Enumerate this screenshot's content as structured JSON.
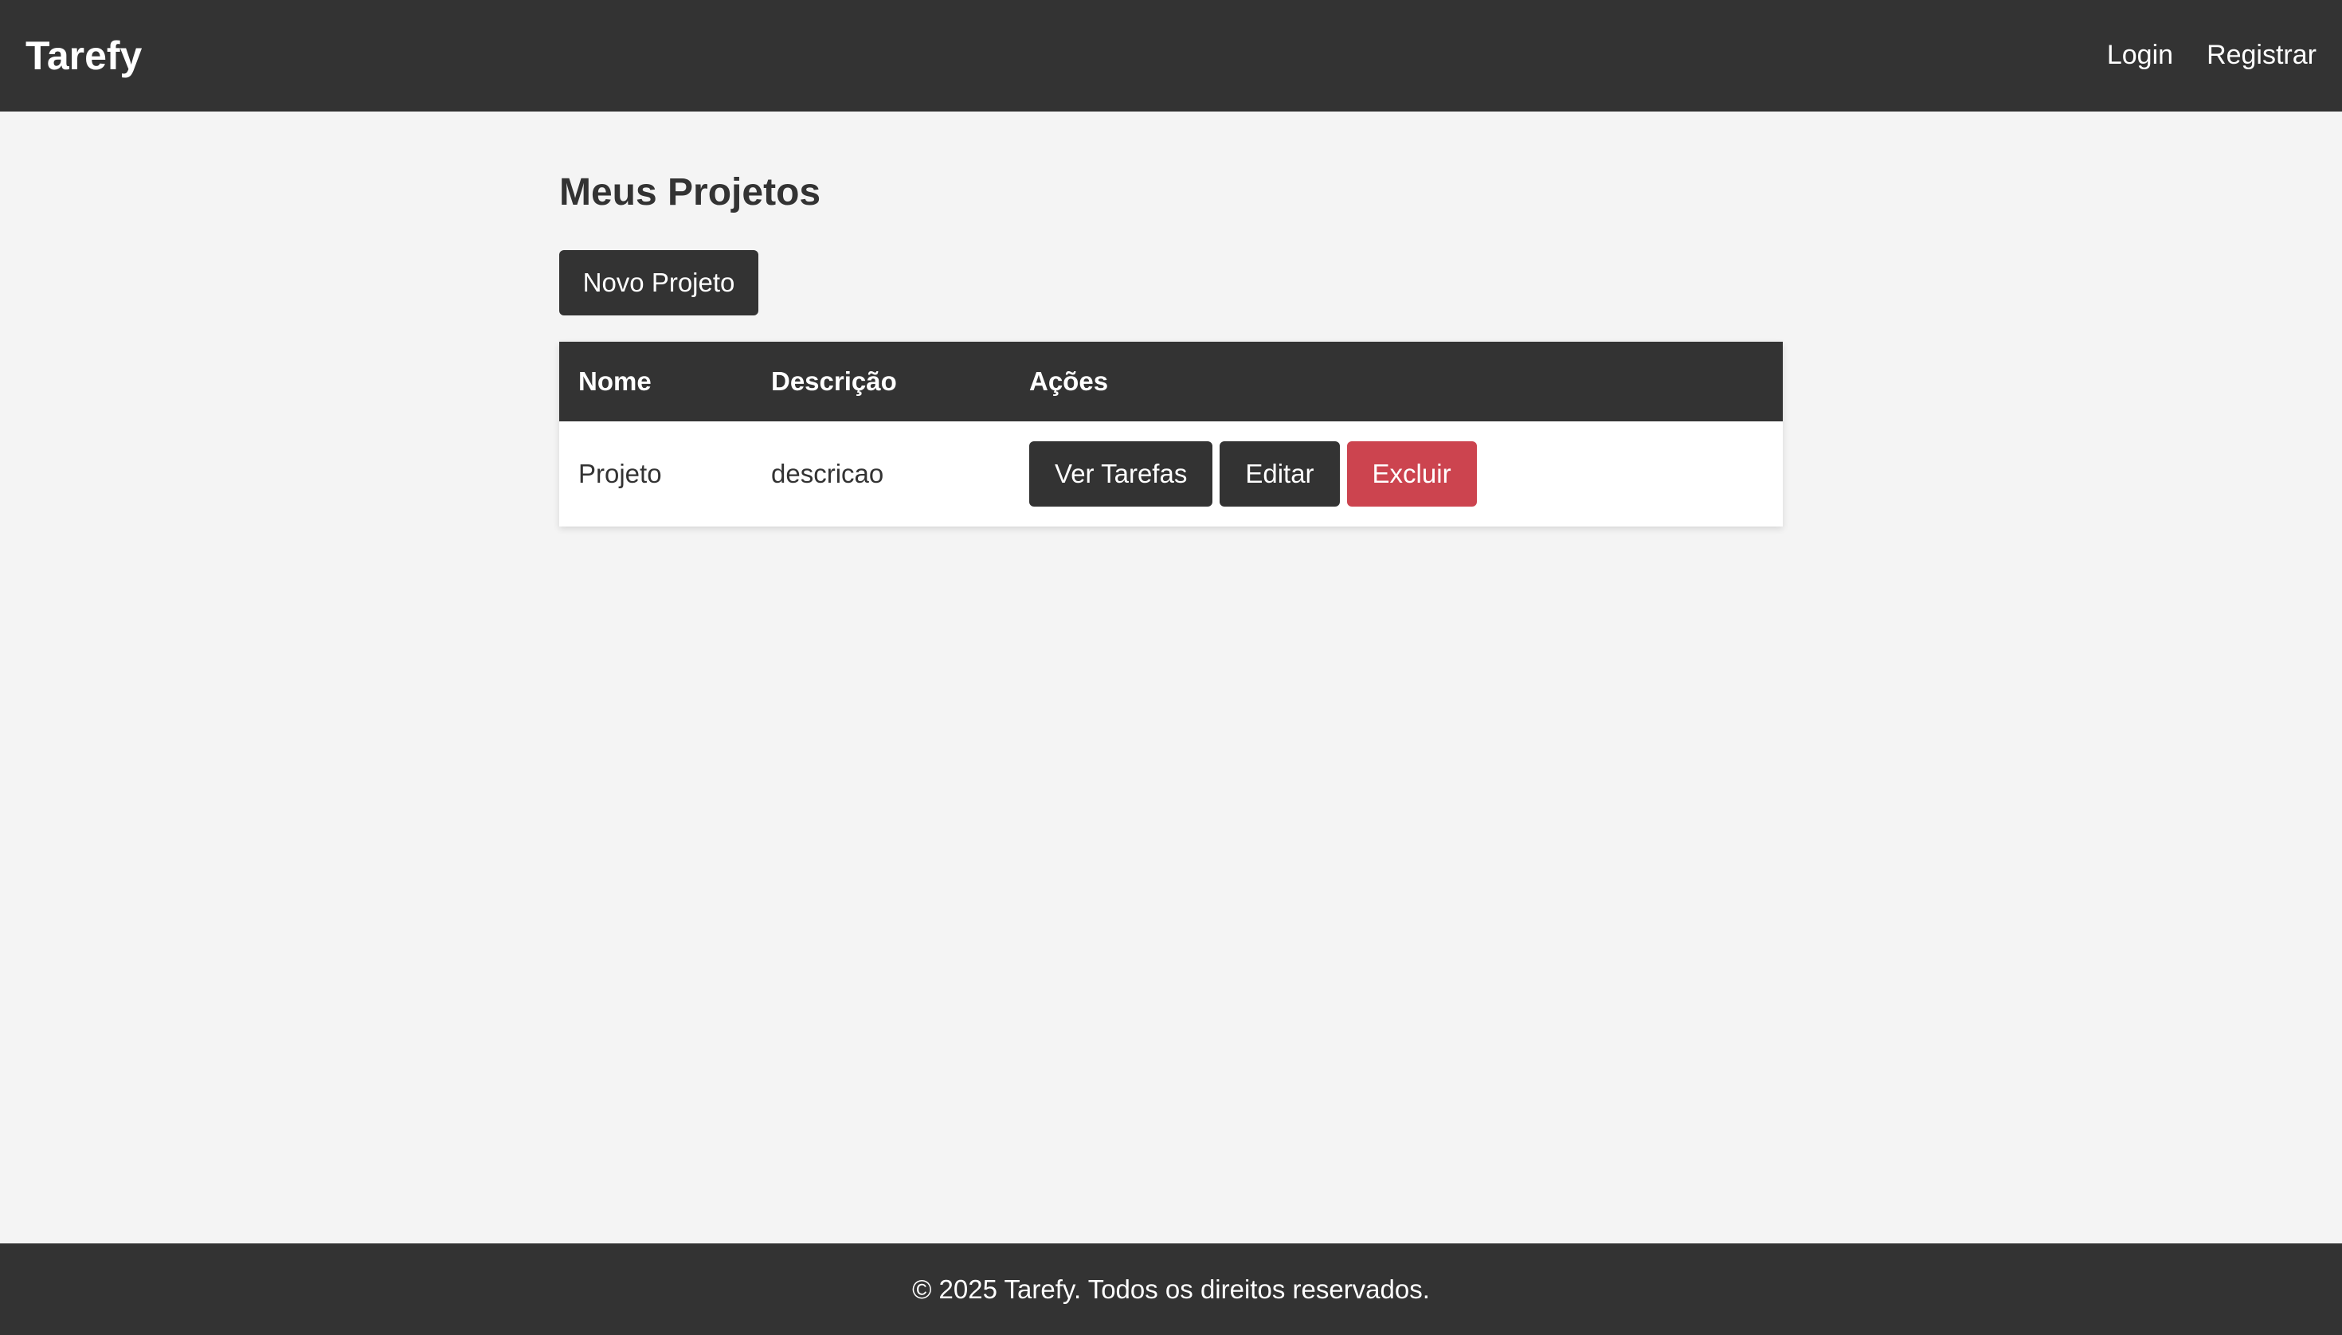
{
  "header": {
    "brand": "Tarefy",
    "nav": [
      {
        "label": "Login"
      },
      {
        "label": "Registrar"
      }
    ]
  },
  "main": {
    "title": "Meus Projetos",
    "new_project_label": "Novo Projeto",
    "table": {
      "columns": [
        "Nome",
        "Descrição",
        "Ações"
      ],
      "rows": [
        {
          "name": "Projeto",
          "description": "descricao",
          "actions": {
            "view_tasks": "Ver Tarefas",
            "edit": "Editar",
            "delete": "Excluir"
          }
        }
      ]
    }
  },
  "footer": {
    "text": "© 2025 Tarefy. Todos os direitos reservados."
  },
  "colors": {
    "header_bg": "#333333",
    "page_bg": "#f4f4f4",
    "danger": "#cc444f"
  }
}
